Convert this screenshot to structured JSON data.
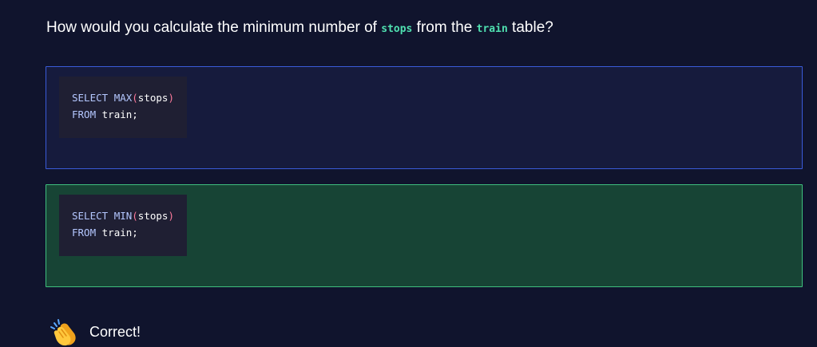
{
  "question": {
    "prefix": "How would you calculate the minimum number of ",
    "code1": "stops",
    "middle": " from the ",
    "code2": "train",
    "suffix": " table?"
  },
  "options": [
    {
      "line1_kw": "SELECT ",
      "line1_fn": "MAX",
      "line1_open": "(",
      "line1_arg": "stops",
      "line1_close": ")",
      "line2_kw": "FROM ",
      "line2_rest": "train;"
    },
    {
      "line1_kw": "SELECT ",
      "line1_fn": "MIN",
      "line1_open": "(",
      "line1_arg": "stops",
      "line1_close": ")",
      "line2_kw": "FROM ",
      "line2_rest": "train;"
    }
  ],
  "feedback": {
    "icon": "clapping-hands-icon",
    "text": "Correct!"
  },
  "colors": {
    "background": "#10142d",
    "inline_code": "#4fe0b0",
    "option_default_border": "#3a5bd9",
    "option_correct_border": "#3fbf7e",
    "option_correct_bg": "#174435"
  }
}
